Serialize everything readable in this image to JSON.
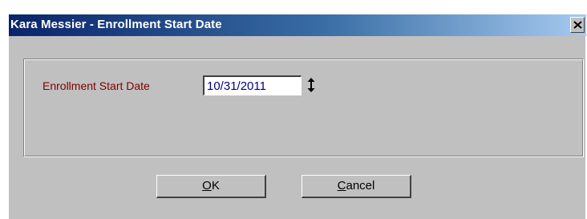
{
  "window": {
    "title": "Kara Messier - Enrollment Start Date",
    "close_glyph": "close-icon"
  },
  "form": {
    "enrollment_label": "Enrollment Start Date",
    "enrollment_value": "10/31/2011",
    "spin_icon": "up-down-arrow-icon"
  },
  "buttons": {
    "ok_mnemonic": "O",
    "ok_rest": "K",
    "cancel_mnemonic": "C",
    "cancel_rest": "ancel"
  },
  "colors": {
    "titlebar_start": "#0a246a",
    "titlebar_end": "#a6caf0",
    "label_color": "#800000",
    "input_text_color": "#000080",
    "dialog_face": "#c0c0c0"
  }
}
